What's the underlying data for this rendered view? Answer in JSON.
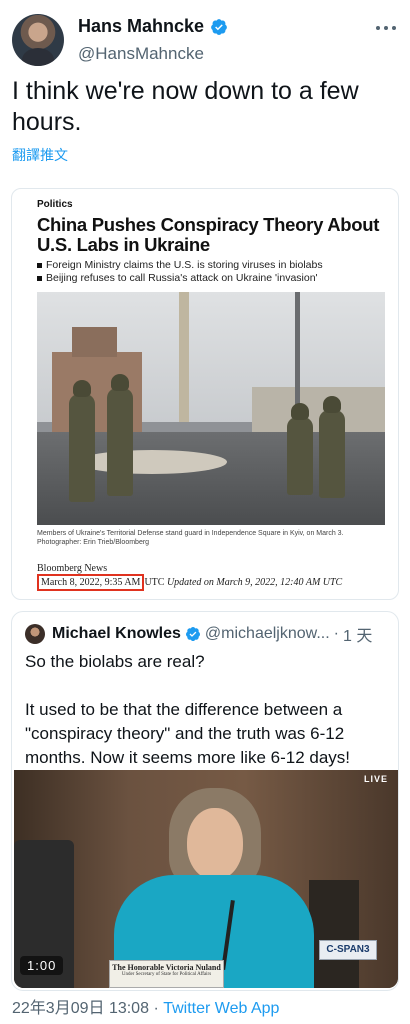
{
  "author": {
    "display_name": "Hans Mahncke",
    "handle": "@HansMahncke"
  },
  "tweet": {
    "text": "I think we're now down to a few hours.",
    "translate_label": "翻譯推文"
  },
  "article": {
    "section": "Politics",
    "headline": "China Pushes Conspiracy Theory About U.S. Labs in Ukraine",
    "bullets": [
      "Foreign Ministry claims the U.S. is storing viruses in biolabs",
      "Beijing refuses to call Russia's attack on Ukraine 'invasion'"
    ],
    "caption": "Members of Ukraine's Territorial Defense stand guard in Independence Square in Kyiv, on March 3. Photographer: Erin Trieb/Bloomberg",
    "source": "Bloomberg News",
    "date": "March 8, 2022, 9:35 AM",
    "date_suffix": "UTC",
    "updated": "Updated on March 9, 2022, 12:40 AM UTC"
  },
  "quoted": {
    "display_name": "Michael Knowles",
    "handle": "@michaeljknow...",
    "separator": "·",
    "time": "1 天",
    "para1": "So the biolabs are real?",
    "para2": "It used to be that the difference between a \"conspiracy theory\" and the truth was 6-12 months. Now it seems more like 6-12 days!",
    "video": {
      "live_label": "LIVE",
      "channel": "C-SPAN3",
      "duration": "1:00",
      "nameplate": "The Honorable Victoria Nuland",
      "nameplate_sub": "Under Secretary of State for Political Affairs"
    }
  },
  "footer": {
    "timestamp": "22年3月09日 13:08",
    "separator": "·",
    "app": "Twitter Web App"
  },
  "colors": {
    "link": "#1d9bf0",
    "verified": "#1d9bf0",
    "highlight_box": "#e0321f"
  },
  "icons": [
    "verified-badge-icon",
    "more-options-icon"
  ]
}
